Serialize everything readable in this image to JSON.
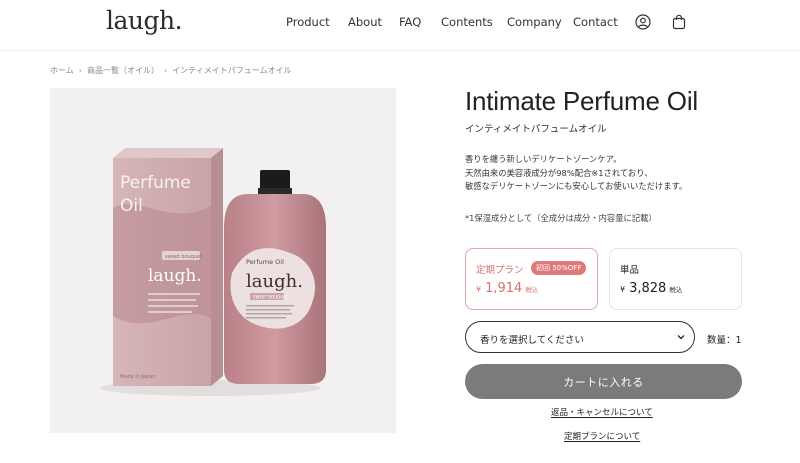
{
  "header": {
    "logo": "laugh.",
    "nav": [
      "Product",
      "About",
      "FAQ",
      "Contents",
      "Company",
      "Contact"
    ],
    "account_icon": "user-icon",
    "cart_icon": "shopping-bag-icon"
  },
  "breadcrumb": [
    "ホーム",
    "商品一覧（オイル）",
    "インティメイトパフュームオイル"
  ],
  "product": {
    "image_texts": {
      "box_title_line1": "Perfume",
      "box_title_line2": "Oil",
      "box_tag": "sweet bouquet",
      "box_logo": "laugh.",
      "box_footer": "Made in Japan",
      "bottle_title": "Perfume Oil",
      "bottle_logo": "laugh.",
      "bottle_tag": "SWEET BOUQUET"
    },
    "title": "Intimate Perfume Oil",
    "subtitle": "インティメイトパフュームオイル",
    "description": [
      "香りを纏う新しいデリケートゾーンケア。",
      "天然由来の美容液成分が98%配合※1されており、",
      "敏感なデリケートゾーンにも安心してお使いいただけます。"
    ],
    "note": "*1保湿成分として（全成分は成分・内容量に記載）"
  },
  "plans": {
    "subscription": {
      "label": "定期プラン",
      "badge": "初回 50%OFF",
      "currency": "¥",
      "price": "1,914",
      "tax": "税込"
    },
    "single": {
      "label": "単品",
      "currency": "¥",
      "price": "3,828",
      "tax": "税込"
    }
  },
  "scent_select": {
    "placeholder": "香りを選択してください"
  },
  "quantity": "数量：1",
  "cart_button": "カートに入れる",
  "links": {
    "returns": "返品・キャンセルについて",
    "subscription_info": "定期プランについて"
  },
  "colors": {
    "accent": "#d86f6f",
    "button": "#7c7a7a",
    "product_pink": "#c9989f"
  }
}
